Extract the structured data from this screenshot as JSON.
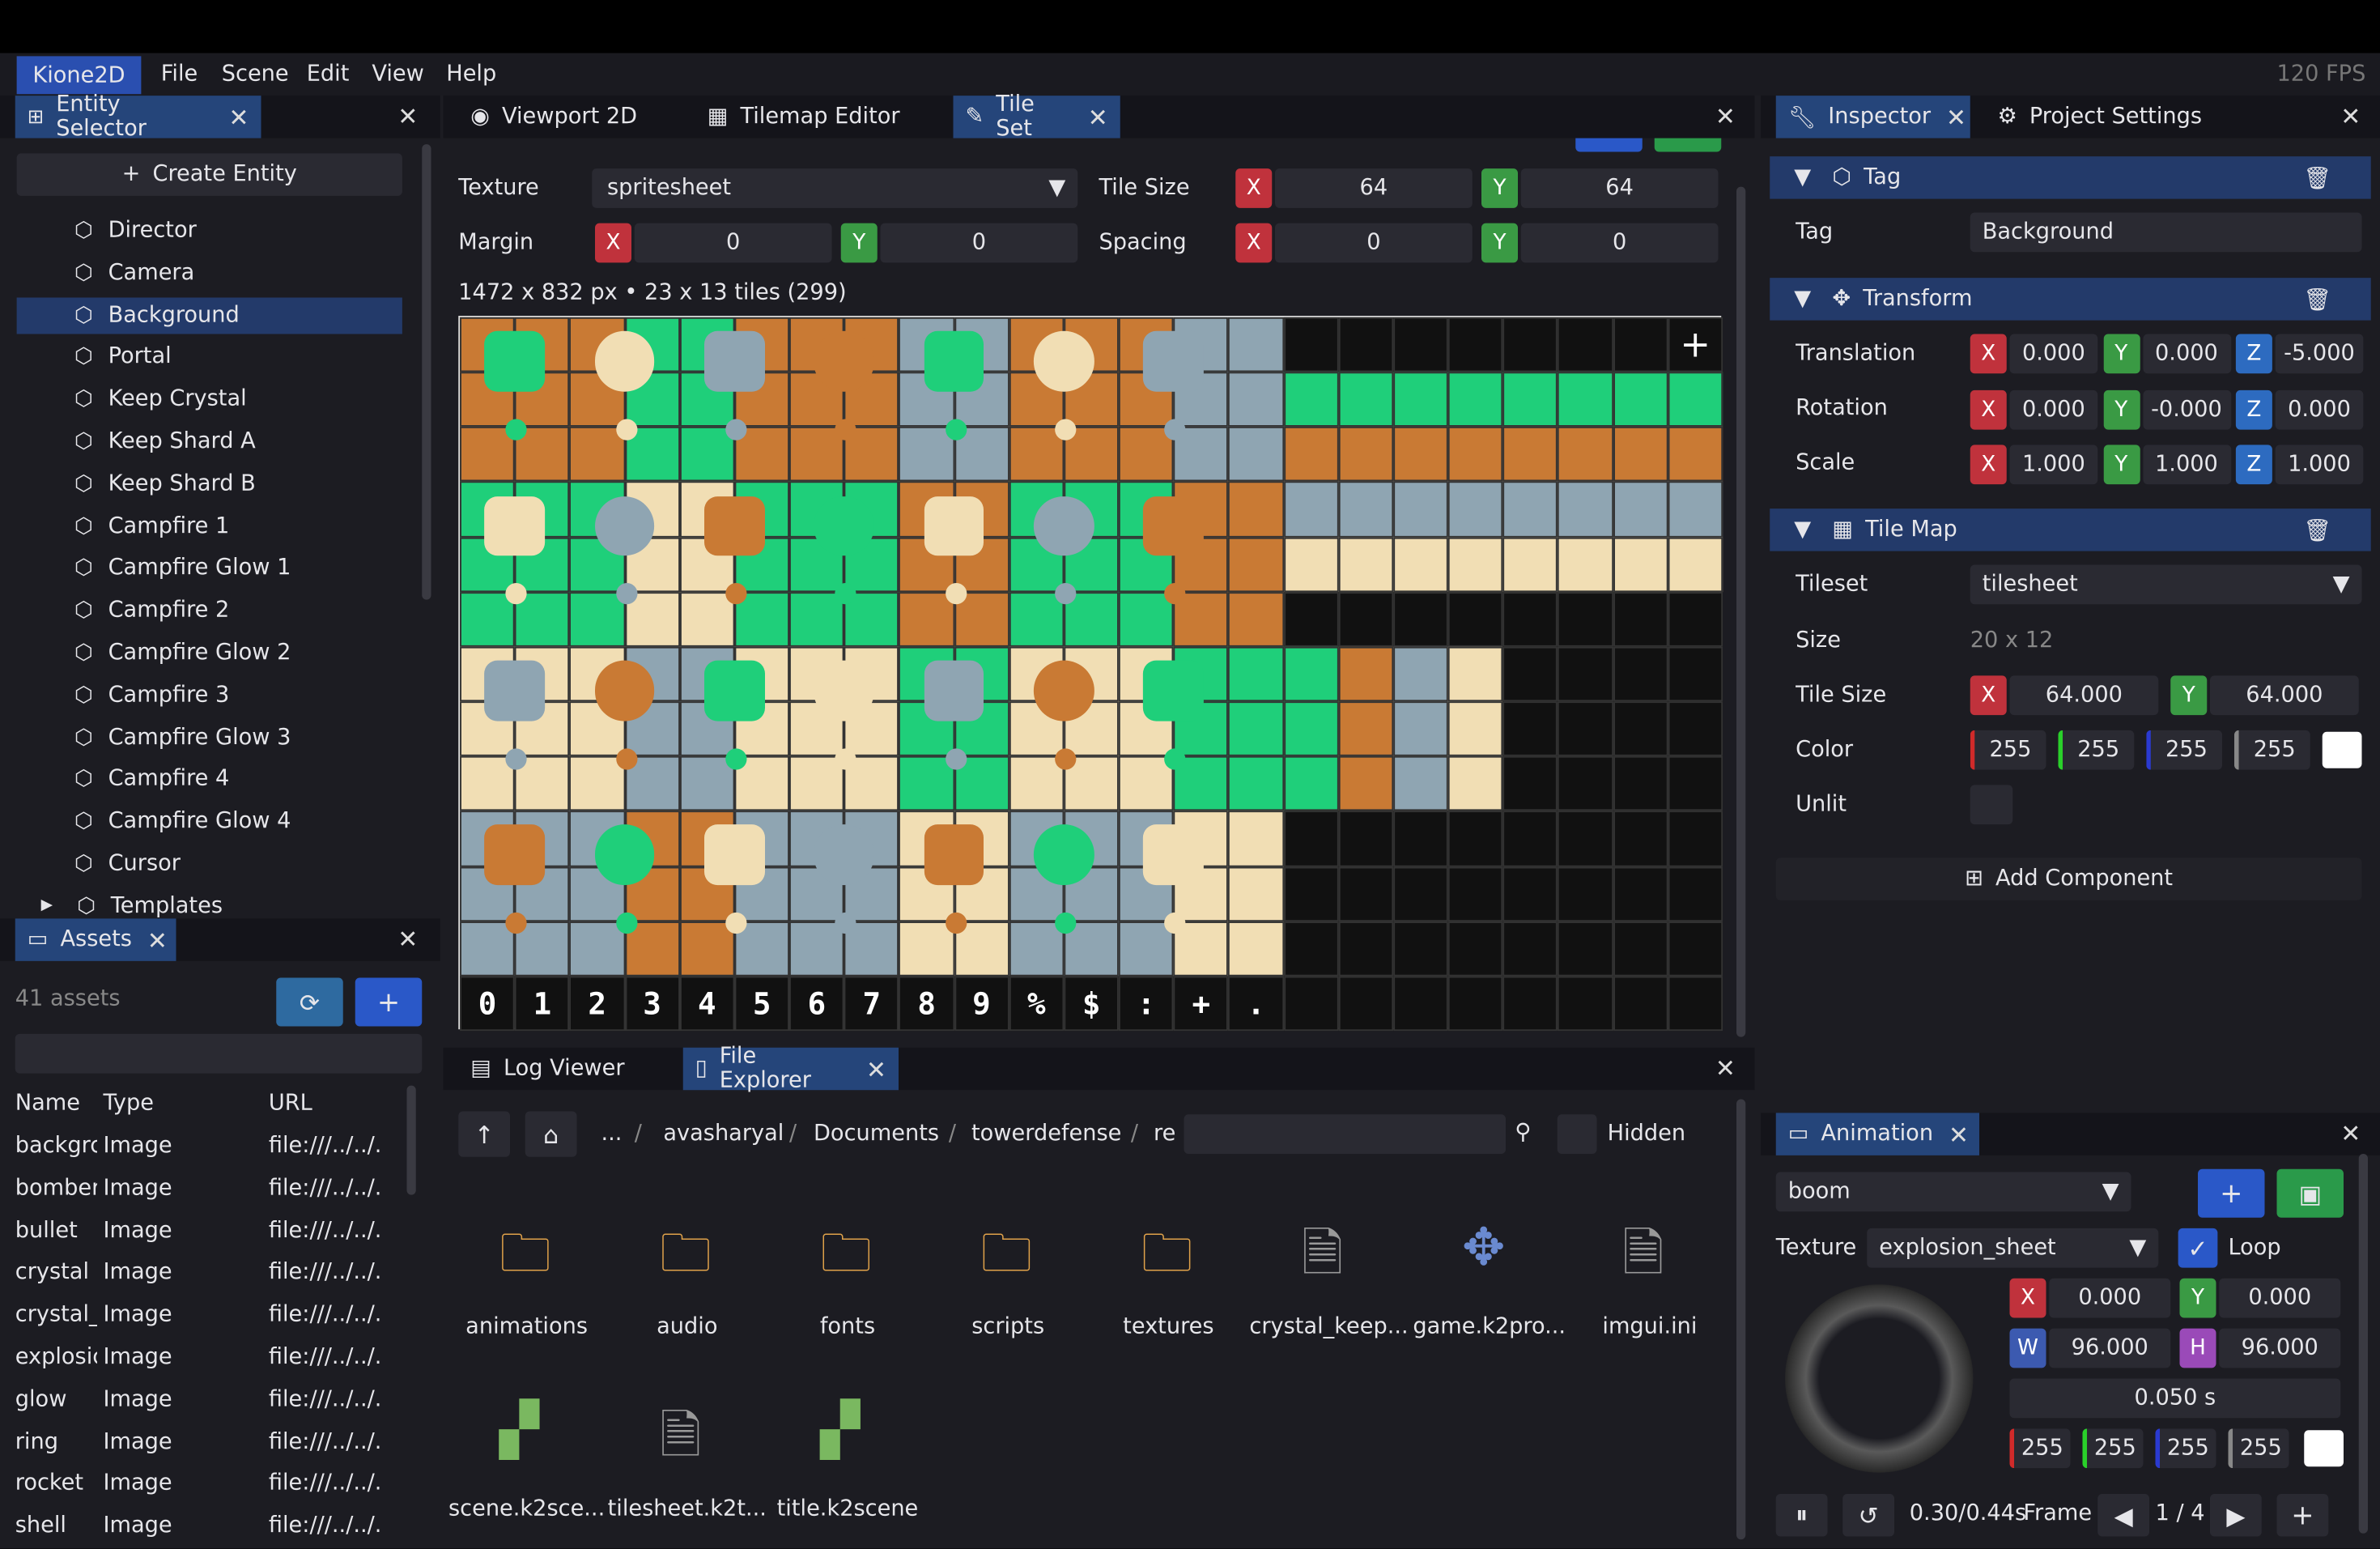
{
  "app": {
    "name": "Kione2D",
    "fps": "120 FPS"
  },
  "menu": [
    "File",
    "Scene",
    "Edit",
    "View",
    "Help"
  ],
  "entity_panel": {
    "tab": "Entity Selector",
    "create_label": "Create Entity",
    "selected": "Background",
    "entities": [
      "Director",
      "Camera",
      "Background",
      "Portal",
      "Keep Crystal",
      "Keep Shard A",
      "Keep Shard B",
      "Campfire 1",
      "Campfire Glow 1",
      "Campfire 2",
      "Campfire Glow 2",
      "Campfire 3",
      "Campfire Glow 3",
      "Campfire 4",
      "Campfire Glow 4",
      "Cursor",
      "Templates"
    ]
  },
  "assets_panel": {
    "tab": "Assets",
    "count": "41 assets",
    "columns": [
      "Name",
      "Type",
      "URL"
    ],
    "rows": [
      [
        "backgrc",
        "Image",
        "file:///../../."
      ],
      [
        "bomber",
        "Image",
        "file:///../../."
      ],
      [
        "bullet",
        "Image",
        "file:///../../."
      ],
      [
        "crystal",
        "Image",
        "file:///../../."
      ],
      [
        "crystal_",
        "Image",
        "file:///../../."
      ],
      [
        "explosic",
        "Image",
        "file:///../../."
      ],
      [
        "glow",
        "Image",
        "file:///../../."
      ],
      [
        "ring",
        "Image",
        "file:///../../."
      ],
      [
        "rocket",
        "Image",
        "file:///../../."
      ],
      [
        "shell",
        "Image",
        "file:///../../."
      ]
    ]
  },
  "center_tabs": [
    "Viewport 2D",
    "Tilemap Editor",
    "Tile Set"
  ],
  "tileset": {
    "texture_label": "Texture",
    "texture_value": "spritesheet",
    "tile_size_label": "Tile Size",
    "tile_x": "64",
    "tile_y": "64",
    "margin_label": "Margin",
    "margin_x": "0",
    "margin_y": "0",
    "spacing_label": "Spacing",
    "spacing_x": "0",
    "spacing_y": "0",
    "info": "1472 x 832 px  •  23 x 13 tiles (299)",
    "bottom_glyphs": [
      "0",
      "1",
      "2",
      "3",
      "4",
      "5",
      "6",
      "7",
      "8",
      "9",
      "%",
      "$",
      ":",
      "+",
      "."
    ]
  },
  "bottom_tabs": [
    "Log Viewer",
    "File Explorer"
  ],
  "file_explorer": {
    "path": [
      "...",
      "avasharyal",
      "Documents",
      "towerdefense",
      "re"
    ],
    "hidden_label": "Hidden",
    "items": [
      "animations",
      "audio",
      "fonts",
      "scripts",
      "textures",
      "crystal_keep...",
      "game.k2pro...",
      "imgui.ini",
      "scene.k2sce...",
      "tilesheet.k2t...",
      "title.k2scene"
    ]
  },
  "inspector": {
    "tabs": [
      "Inspector",
      "Project Settings"
    ],
    "tag_section": "Tag",
    "tag_label": "Tag",
    "tag_value": "Background",
    "transform_section": "Transform",
    "translation_label": "Translation",
    "tx": "0.000",
    "ty": "0.000",
    "tz": "-5.000",
    "rotation_label": "Rotation",
    "rx": "0.000",
    "ry": "-0.000",
    "rz": "0.000",
    "scale_label": "Scale",
    "sx": "1.000",
    "sy": "1.000",
    "sz": "1.000",
    "tilemap_section": "Tile Map",
    "tileset_label": "Tileset",
    "tileset_value": "tilesheet",
    "size_label": "Size",
    "size_value": "20 x 12",
    "tilesize_label": "Tile Size",
    "tsx": "64.000",
    "tsy": "64.000",
    "color_label": "Color",
    "cr": "255",
    "cg": "255",
    "cb": "255",
    "ca": "255",
    "unlit_label": "Unlit",
    "add_component": "Add Component"
  },
  "animation": {
    "tab": "Animation",
    "anim_value": "boom",
    "texture_label": "Texture",
    "texture_value": "explosion_sheet",
    "loop_label": "Loop",
    "x": "0.000",
    "y": "0.000",
    "w": "96.000",
    "h": "96.000",
    "duration": "0.050 s",
    "r": "255",
    "g": "255",
    "b": "255",
    "a": "255",
    "time": "0.30/0.44s",
    "frame_label": "Frame",
    "frame_value": "1 / 4"
  },
  "colors": {
    "accent": "#233a6a",
    "green": "#1fcf7a",
    "orange": "#c97a34",
    "cream": "#f1deb4",
    "slate": "#8fa5b2"
  }
}
